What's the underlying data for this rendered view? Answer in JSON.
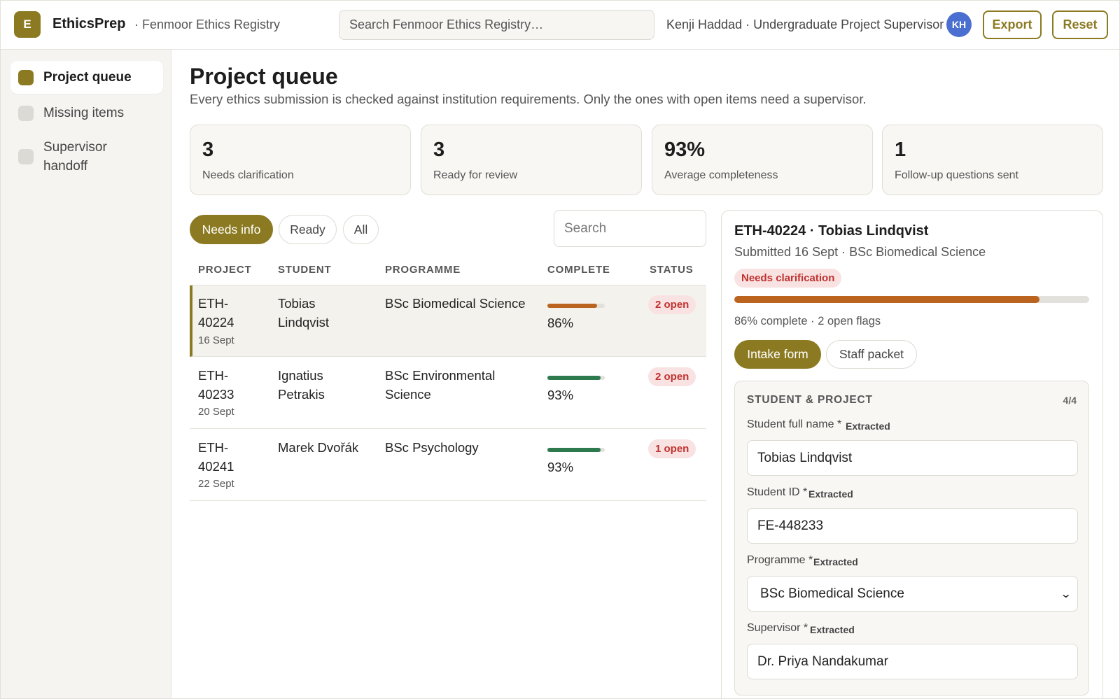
{
  "app": {
    "logo_letter": "E",
    "name": "EthicsPrep",
    "registry": "· Fenmoor Ethics Registry",
    "search_placeholder": "Search Fenmoor Ethics Registry…",
    "user": "Kenji Haddad · Undergraduate Project Supervisor",
    "avatar_initials": "KH",
    "export_label": "Export",
    "reset_label": "Reset",
    "brand_color": "#8c7a22"
  },
  "sidebar": {
    "items": [
      {
        "label": "Project queue",
        "active": true
      },
      {
        "label": "Missing items",
        "active": false
      },
      {
        "label": "Supervisor handoff",
        "active": false
      }
    ]
  },
  "main": {
    "title": "Project queue",
    "subtitle": "Every ethics submission is checked against institution requirements. Only the ones with open items need a supervisor.",
    "stats": [
      {
        "value": "3",
        "label": "Needs clarification"
      },
      {
        "value": "3",
        "label": "Ready for review"
      },
      {
        "value": "93%",
        "label": "Average completeness"
      },
      {
        "value": "1",
        "label": "Follow-up questions sent"
      }
    ],
    "filters": [
      {
        "label": "Needs info",
        "active": true
      },
      {
        "label": "Ready",
        "active": false
      },
      {
        "label": "All",
        "active": false
      }
    ],
    "search_placeholder": "Search",
    "columns": [
      "PROJECT",
      "STUDENT",
      "PROGRAMME",
      "COMPLETE",
      "STATUS"
    ],
    "rows": [
      {
        "id_line1": "ETH-",
        "id_line2": "40224",
        "date": "16 Sept",
        "student_line1": "Tobias",
        "student_line2": "Lindqvist",
        "programme_line1": "BSc Biomedical Science",
        "programme_line2": "",
        "complete": "86%",
        "complete_fraction": 0.86,
        "bar_color": "#bb6420",
        "status": "2 open",
        "selected": true
      },
      {
        "id_line1": "ETH-",
        "id_line2": "40233",
        "date": "20 Sept",
        "student_line1": "Ignatius",
        "student_line2": "Petrakis",
        "programme_line1": "BSc Environmental",
        "programme_line2": "Science",
        "complete": "93%",
        "complete_fraction": 0.93,
        "bar_color": "#2e7a4f",
        "status": "2 open",
        "selected": false
      },
      {
        "id_line1": "ETH-",
        "id_line2": "40241",
        "date": "22 Sept",
        "student_line1": "Marek Dvořák",
        "student_line2": "",
        "programme_line1": "BSc Psychology",
        "programme_line2": "",
        "complete": "93%",
        "complete_fraction": 0.93,
        "bar_color": "#2e7a4f",
        "status": "1 open",
        "selected": false
      }
    ]
  },
  "detail": {
    "title": "ETH-40224 · Tobias Lindqvist",
    "subtitle": "Submitted 16 Sept · BSc Biomedical Science",
    "badge": "Needs clarification",
    "progress_fraction": 0.86,
    "meta": "86% complete · 2 open flags",
    "tabs": [
      {
        "label": "Intake form",
        "active": true
      },
      {
        "label": "Staff packet",
        "active": false
      }
    ],
    "section": {
      "title": "STUDENT & PROJECT",
      "count": "4/4",
      "fields": [
        {
          "label": "Student full name *",
          "tag": "Extracted",
          "value": "Tobias Lindqvist",
          "type": "text"
        },
        {
          "label": "Student ID *",
          "tag": "Extracted",
          "value": "FE-448233",
          "type": "text"
        },
        {
          "label": "Programme *",
          "tag": "Extracted",
          "value": "BSc Biomedical Science",
          "type": "select"
        },
        {
          "label": "Supervisor *",
          "tag": "Extracted",
          "value": "Dr. Priya Nandakumar",
          "type": "text"
        }
      ]
    }
  }
}
